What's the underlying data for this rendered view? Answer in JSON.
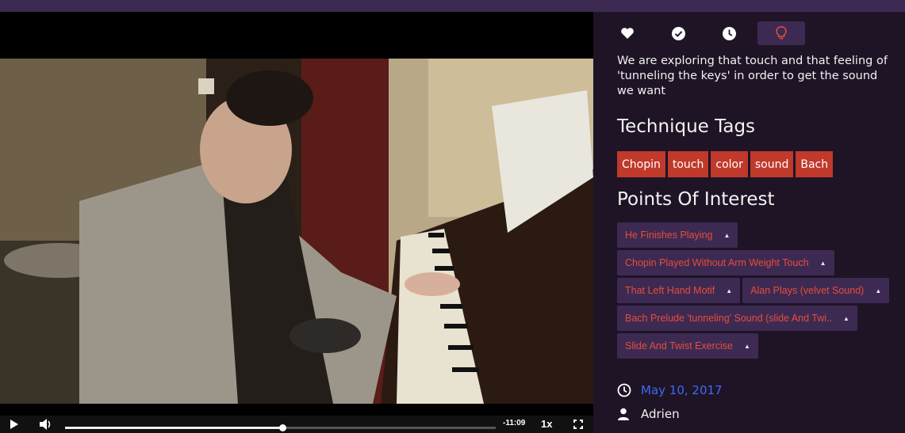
{
  "video": {
    "time_remaining": "-11:09",
    "speed": "1x",
    "progress": 0.504
  },
  "actions": {
    "icons": [
      "heart-icon",
      "check-circle-icon",
      "clock-icon",
      "lightbulb-icon"
    ]
  },
  "description": "We are exploring that touch and that feeling of 'tunneling the keys' in order to get the sound we want",
  "technique_tags": {
    "title": "Technique Tags",
    "items": [
      "Chopin",
      "touch",
      "color",
      "sound",
      "Bach"
    ]
  },
  "points_of_interest": {
    "title": "Points Of Interest",
    "items": [
      "He Finishes Playing",
      "Chopin Played Without Arm Weight Touch",
      "That Left Hand Motif",
      "Alan Plays (velvet Sound)",
      "Bach Prelude 'tunneling' Sound (slide And Twi..",
      "Slide And Twist Exercise"
    ]
  },
  "meta": {
    "date": "May 10, 2017",
    "author": "Adrien"
  },
  "colors": {
    "tag_bg": "#c0392b",
    "poi_bg": "#3d2a52",
    "poi_text": "#e74c3c",
    "date_link": "#3d6cf0"
  }
}
